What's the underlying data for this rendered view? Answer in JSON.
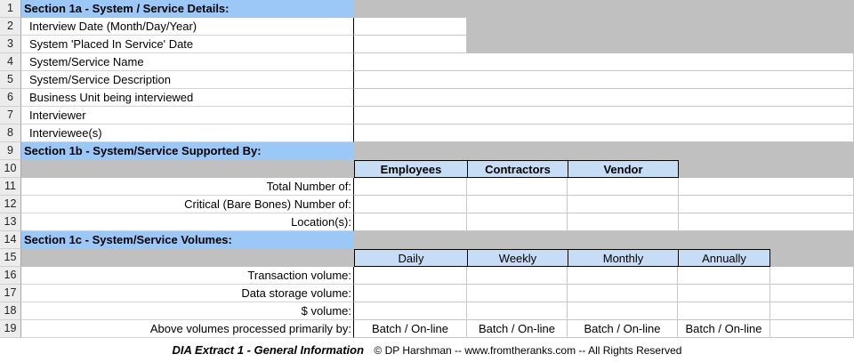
{
  "rows": [
    "1",
    "2",
    "3",
    "4",
    "5",
    "6",
    "7",
    "8",
    "9",
    "10",
    "11",
    "12",
    "13",
    "14",
    "15",
    "16",
    "17",
    "18",
    "19"
  ],
  "section_1a": {
    "title": "Section 1a - System / Service Details:",
    "fields": [
      "Interview Date (Month/Day/Year)",
      "System 'Placed In Service' Date",
      "System/Service Name",
      "System/Service Description",
      "Business Unit being interviewed",
      "Interviewer",
      "Interviewee(s)"
    ]
  },
  "section_1b": {
    "title": "Section 1b - System/Service Supported By:",
    "columns": [
      "Employees",
      "Contractors",
      "Vendor"
    ],
    "rows": [
      "Total Number of:",
      "Critical (Bare Bones) Number of:",
      "Location(s):"
    ]
  },
  "section_1c": {
    "title": "Section 1c - System/Service Volumes:",
    "columns": [
      "Daily",
      "Weekly",
      "Monthly",
      "Annually"
    ],
    "rows": [
      "Transaction volume:",
      "Data storage volume:",
      "$ volume:",
      "Above volumes processed primarily by:"
    ],
    "processed_values": [
      "Batch / On-line",
      "Batch / On-line",
      "Batch / On-line",
      "Batch / On-line"
    ]
  },
  "footer": {
    "title": "DIA Extract 1 - General Information",
    "credit": "© DP Harshman -- www.fromtheranks.com -- All Rights Reserved"
  },
  "colors": {
    "section_header": "#9cc8f7",
    "column_header": "#c6ddf5",
    "gray_fill": "#c0c0c0"
  }
}
